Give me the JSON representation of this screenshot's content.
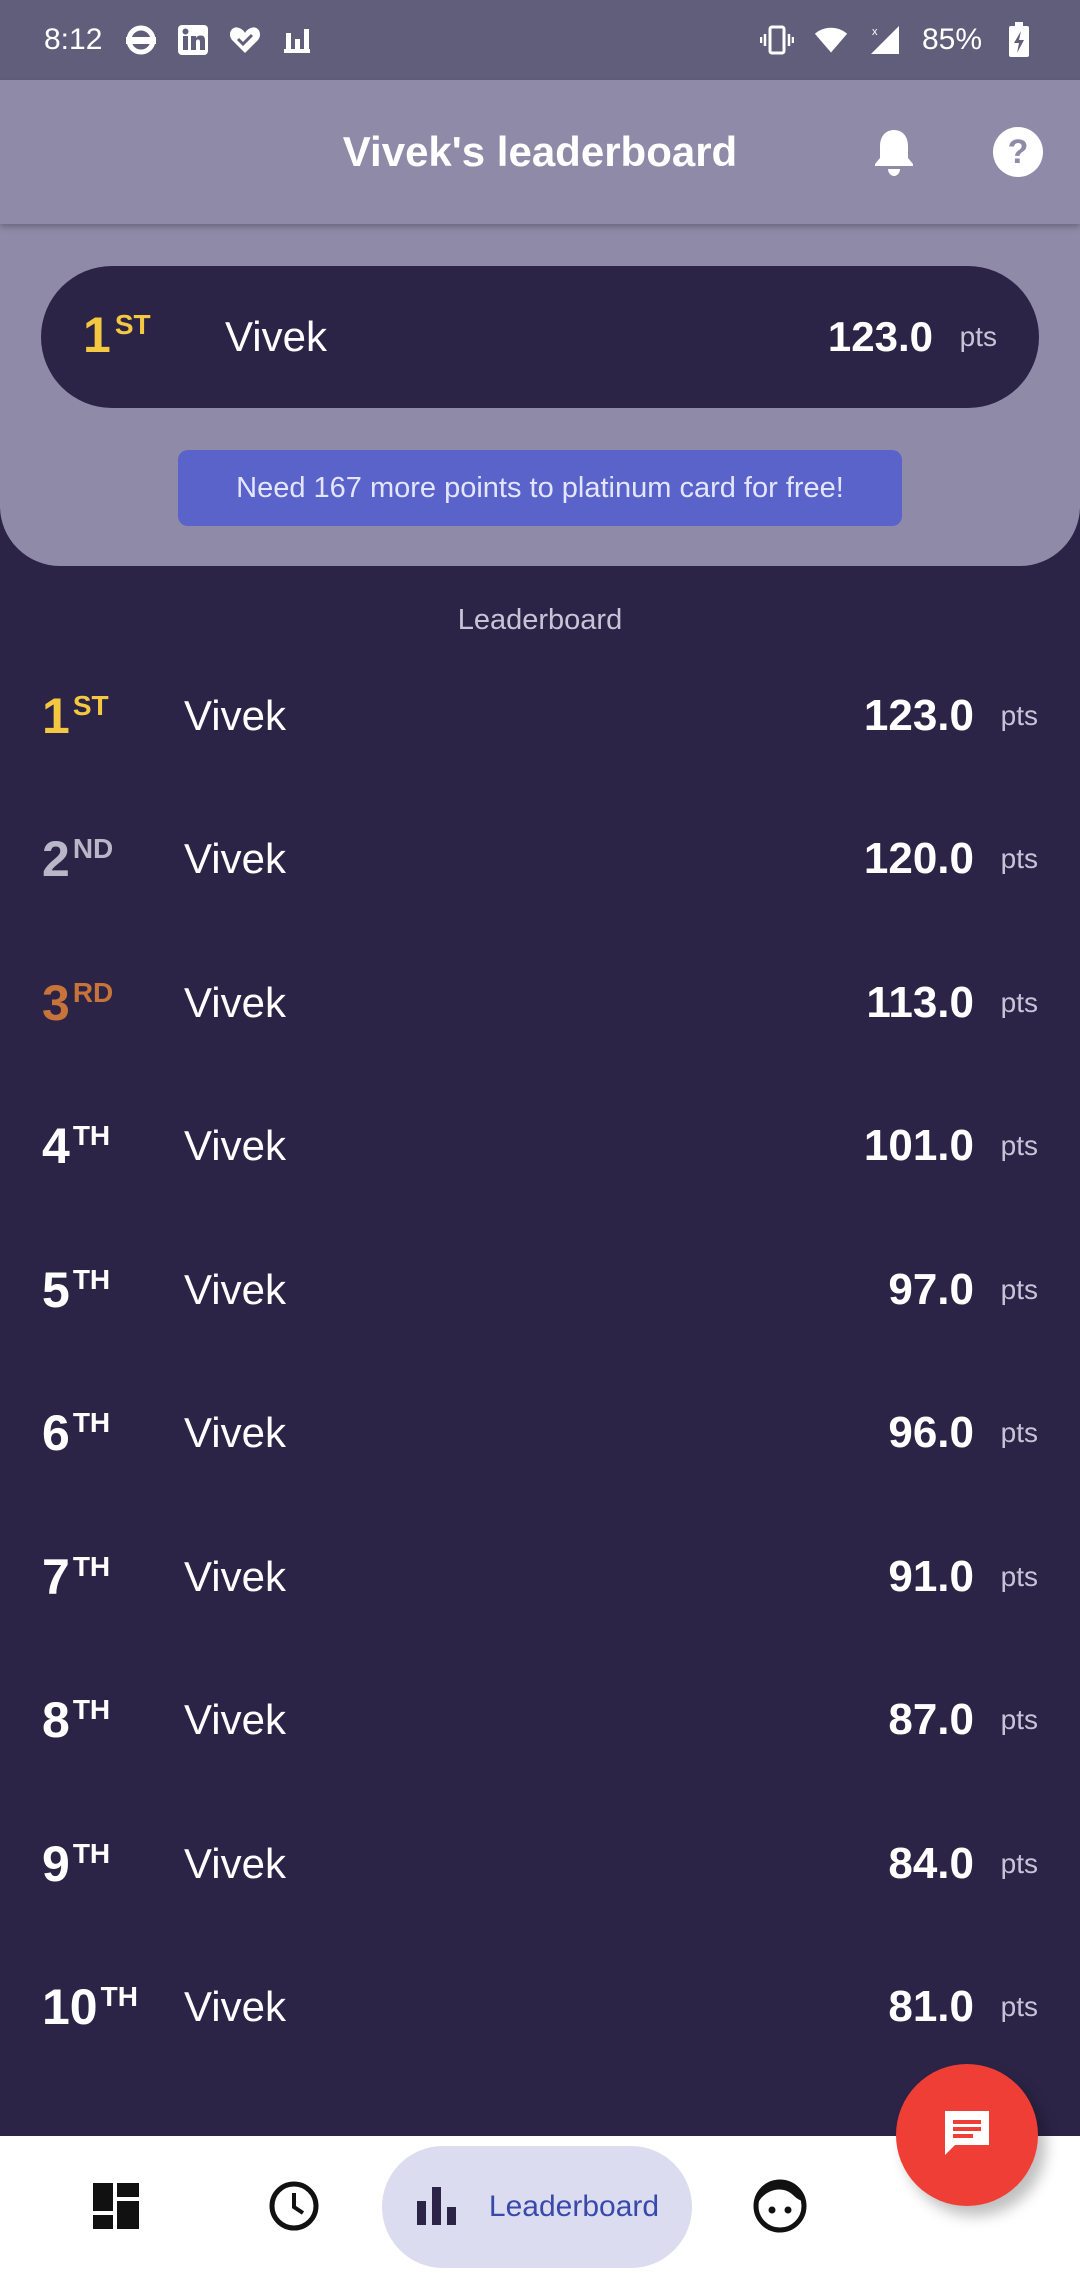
{
  "status_bar": {
    "time": "8:12",
    "battery": "85%",
    "left_icons": [
      "london-underground-icon",
      "linkedin-icon",
      "heart-check-icon",
      "bar-signal-icon"
    ],
    "right_icons": [
      "vibrate-icon",
      "wifi-icon",
      "cell-signal-icon",
      "battery-charging-icon"
    ]
  },
  "app_bar": {
    "title": "Vivek's leaderboard",
    "icons": [
      "bell-icon",
      "help-icon"
    ]
  },
  "top_card": {
    "rank": "1",
    "suffix": "ST",
    "name": "Vivek",
    "score": "123.0",
    "unit": "pts"
  },
  "promo": {
    "text": "Need 167 more points to platinum card for free!"
  },
  "leaderboard": {
    "title": "Leaderboard",
    "rows": [
      {
        "rank": "1",
        "suffix": "ST",
        "name": "Vivek",
        "score": "123.0",
        "unit": "pts"
      },
      {
        "rank": "2",
        "suffix": "ND",
        "name": "Vivek",
        "score": "120.0",
        "unit": "pts"
      },
      {
        "rank": "3",
        "suffix": "RD",
        "name": "Vivek",
        "score": "113.0",
        "unit": "pts"
      },
      {
        "rank": "4",
        "suffix": "TH",
        "name": "Vivek",
        "score": "101.0",
        "unit": "pts"
      },
      {
        "rank": "5",
        "suffix": "TH",
        "name": "Vivek",
        "score": "97.0",
        "unit": "pts"
      },
      {
        "rank": "6",
        "suffix": "TH",
        "name": "Vivek",
        "score": "96.0",
        "unit": "pts"
      },
      {
        "rank": "7",
        "suffix": "TH",
        "name": "Vivek",
        "score": "91.0",
        "unit": "pts"
      },
      {
        "rank": "8",
        "suffix": "TH",
        "name": "Vivek",
        "score": "87.0",
        "unit": "pts"
      },
      {
        "rank": "9",
        "suffix": "TH",
        "name": "Vivek",
        "score": "84.0",
        "unit": "pts"
      },
      {
        "rank": "10",
        "suffix": "TH",
        "name": "Vivek",
        "score": "81.0",
        "unit": "pts"
      }
    ]
  },
  "bottom_nav": {
    "items": [
      "dashboard-icon",
      "clock-icon",
      "bar-chart-icon",
      "face-icon"
    ],
    "active_label": "Leaderboard"
  },
  "colors": {
    "background": "#2b2446",
    "header": "#8f8aa8",
    "promo": "#5a63c9",
    "gold": "#f5c842",
    "silver": "#b9b6c8",
    "bronze": "#c8733a",
    "fab": "#ef3e36",
    "nav_active": "#3949ab"
  }
}
